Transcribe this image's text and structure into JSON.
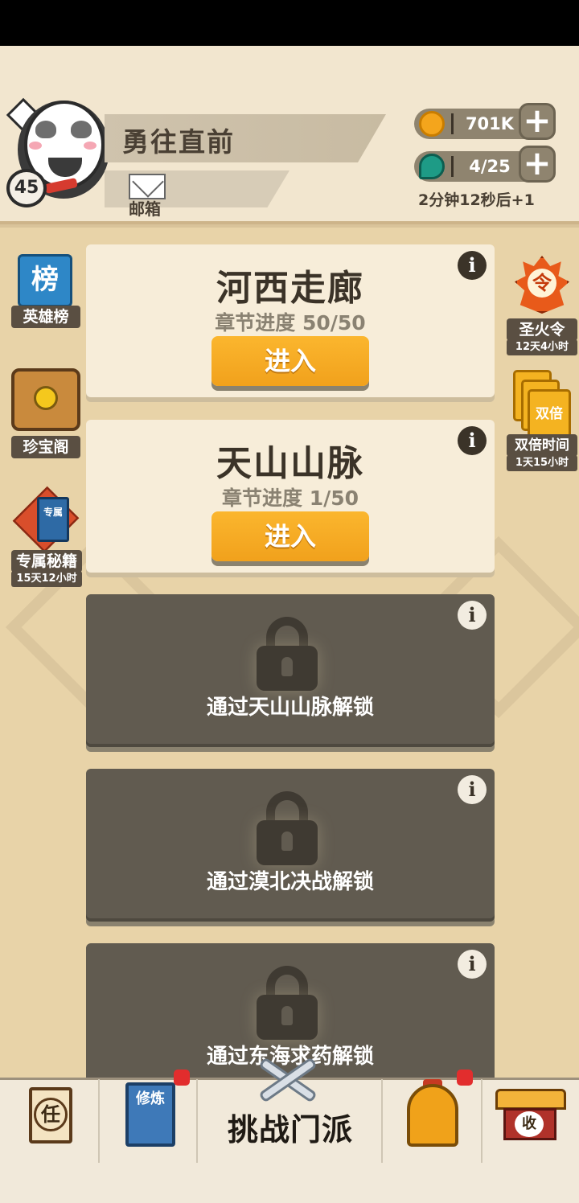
{
  "player": {
    "name": "勇往直前",
    "level": "45",
    "mail_label": "邮箱"
  },
  "currency": {
    "coins": "701K",
    "gems": "4/25",
    "regen_text": "2分钟12秒后+1",
    "plus_symbol": "+"
  },
  "left_menu": [
    {
      "label": "英雄榜",
      "glyph": "榜",
      "icon": "ranking-banner-icon"
    },
    {
      "label": "珍宝阁",
      "icon": "treasure-chest-icon"
    },
    {
      "label": "专属秘籍",
      "sub": "15天12小时",
      "glyph": "专属",
      "icon": "secret-book-icon"
    }
  ],
  "right_menu": [
    {
      "label": "圣火令",
      "sub": "12天4小时",
      "glyph": "令",
      "icon": "sacred-flame-icon"
    },
    {
      "label": "双倍时间",
      "sub": "1天15小时",
      "glyph": "双倍",
      "icon": "double-cards-icon"
    }
  ],
  "chapters": [
    {
      "title": "河西走廊",
      "progress": "章节进度 50/50",
      "button": "进入",
      "status": "unlocked"
    },
    {
      "title": "天山山脉",
      "progress": "章节进度 1/50",
      "button": "进入",
      "status": "unlocked"
    },
    {
      "lock_text": "通过天山山脉解锁",
      "status": "locked"
    },
    {
      "lock_text": "通过漠北决战解锁",
      "status": "locked"
    },
    {
      "lock_text": "通过东海求药解锁",
      "status": "locked"
    }
  ],
  "info_glyph": "i",
  "bottom_nav": {
    "task_glyph": "任",
    "train_glyph": "修炼",
    "challenge_label": "挑战门派",
    "collect_glyph": "收"
  },
  "colors": {
    "background": "#e8d3a8",
    "enter_button": "#f1a11c",
    "locked_card": "#615b50",
    "notification_dot": "#e22d2d"
  }
}
